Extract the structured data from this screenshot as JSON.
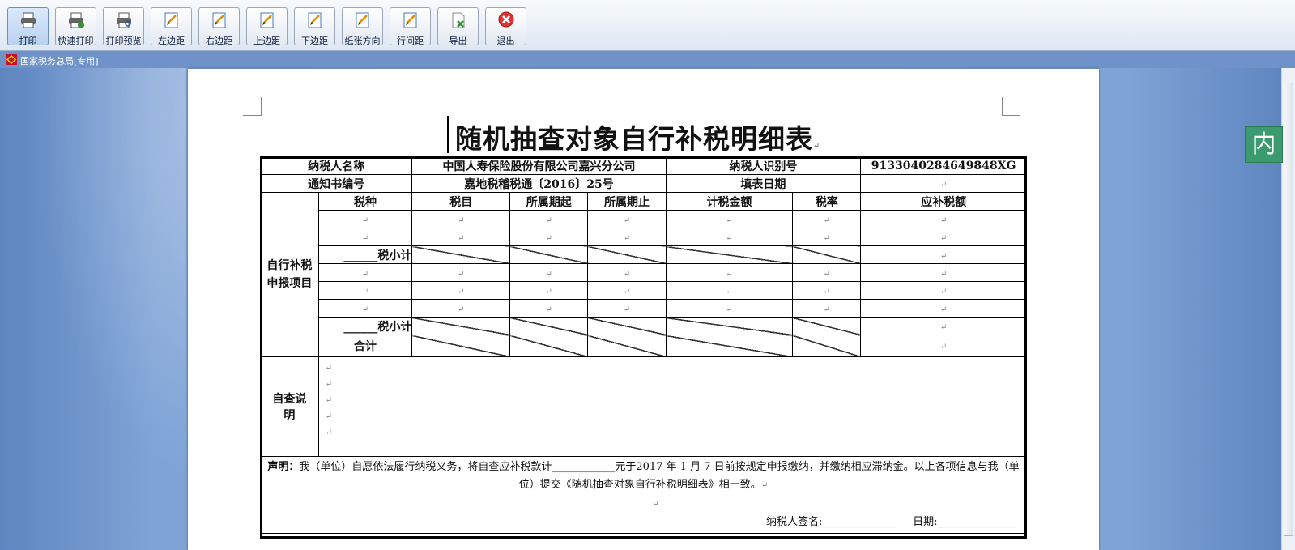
{
  "toolbar": {
    "buttons": [
      {
        "label": "打印",
        "icon": "printer-icon"
      },
      {
        "label": "快速打印",
        "icon": "quick-print-icon"
      },
      {
        "label": "打印预览",
        "icon": "print-preview-icon"
      },
      {
        "label": "左边距",
        "icon": "left-margin-icon"
      },
      {
        "label": "右边距",
        "icon": "right-margin-icon"
      },
      {
        "label": "上边距",
        "icon": "top-margin-icon"
      },
      {
        "label": "下边距",
        "icon": "bottom-margin-icon"
      },
      {
        "label": "纸张方向",
        "icon": "paper-orientation-icon"
      },
      {
        "label": "行间距",
        "icon": "line-spacing-icon"
      },
      {
        "label": "导出",
        "icon": "export-excel-icon"
      },
      {
        "label": "退出",
        "icon": "exit-icon"
      }
    ]
  },
  "document": {
    "window_title": "国家税务总局[专用]",
    "title": "随机抽查对象自行补税明细表",
    "side_badge": "内",
    "paragraph_mark": "↵",
    "rows": {
      "taxpayer_name_label": "纳税人名称",
      "taxpayer_name_value": "中国人寿保险股份有限公司嘉兴分公司",
      "taxpayer_id_label": "纳税人识别号",
      "taxpayer_id_value": "913304028464984​8XG",
      "notice_no_label": "通知书编号",
      "notice_no_value": "嘉地税稽税通〔2016〕25号",
      "fill_date_label": "填表日期"
    },
    "columns": [
      "税种",
      "税目",
      "所属期起",
      "所属期止",
      "计税金额",
      "税率",
      "应补税额"
    ],
    "section_label": "自行补税申报项目",
    "subtotal_label": "______税小计",
    "total_label": "合计",
    "notes_label": "自查说明",
    "declaration": {
      "prefix": "声明：",
      "text1": "我（单位）自愿依法履行纳税义务，将自查应补税款计____________元于",
      "date_text": "2017 年 1 月 7 日",
      "text2": "前按规定申报缴纳，并缴纳相应滞纳金。以上各项信息与我（单位）提交《随机抽查对象自行补税明细表》相一致。",
      "signature": "纳税人签名:______________",
      "date_label": "日期:_______________"
    }
  },
  "colors": {
    "toolbar_bg": "#e8eef6",
    "workspace": "#7ea3d6",
    "badge": "#3c9b6e"
  }
}
